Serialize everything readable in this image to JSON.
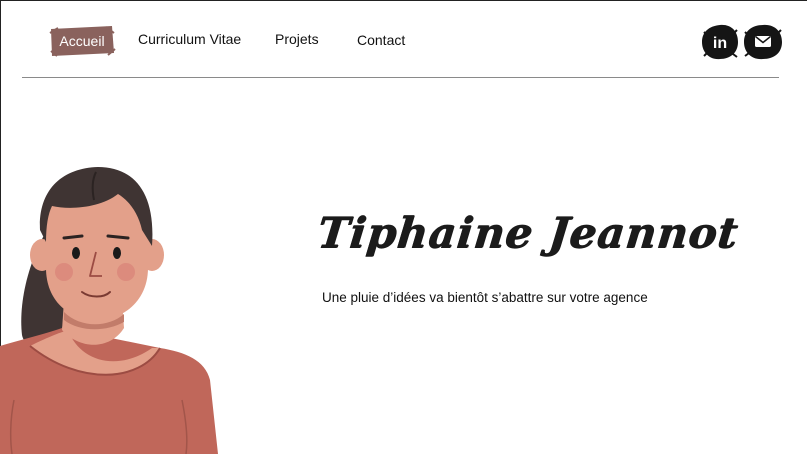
{
  "nav": {
    "items": [
      {
        "label": "Accueil",
        "active": true
      },
      {
        "label": "Curriculum Vitae",
        "active": false
      },
      {
        "label": "Projets",
        "active": false
      },
      {
        "label": "Contact",
        "active": false
      }
    ],
    "active_color": "#8a625d",
    "social": [
      {
        "icon": "linkedin-icon",
        "label": "in"
      },
      {
        "icon": "mail-icon"
      }
    ]
  },
  "hero": {
    "title": "Tiphaine Jeannot",
    "subtitle": "Une pluie d’idées va bientôt s’abattre sur votre agence"
  },
  "colors": {
    "shirt": "#c0675a",
    "skin": "#e3a08a",
    "hair": "#3f3433"
  }
}
